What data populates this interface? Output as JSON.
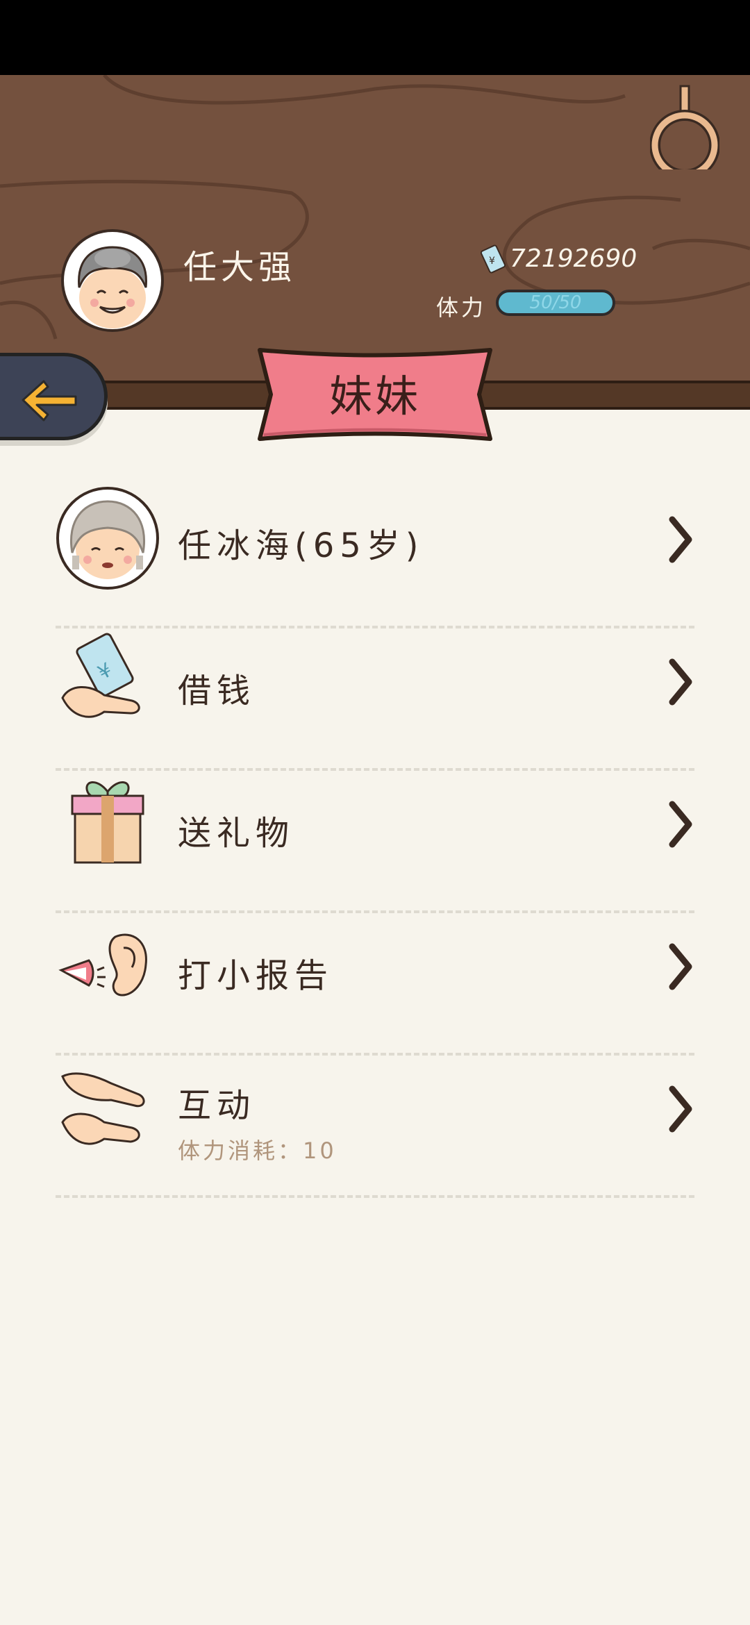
{
  "header": {
    "player_name": "任大强",
    "money": "72192690",
    "stamina_label": "体力",
    "stamina_value": "50/50"
  },
  "banner": {
    "title": "妹妹"
  },
  "menu": {
    "items": [
      {
        "label": "任冰海(65岁)",
        "icon": "grandma-avatar"
      },
      {
        "label": "借钱",
        "icon": "money-hand-icon"
      },
      {
        "label": "送礼物",
        "icon": "gift-icon"
      },
      {
        "label": "打小报告",
        "icon": "whisper-icon"
      },
      {
        "label": "互动",
        "sub": "体力消耗：10",
        "icon": "hands-icon"
      }
    ]
  },
  "colors": {
    "wood": "#74513e",
    "banner": "#f07d8a",
    "stamina": "#5fb9cf",
    "back_button": "#3d4356",
    "arrow": "#f5b233"
  }
}
